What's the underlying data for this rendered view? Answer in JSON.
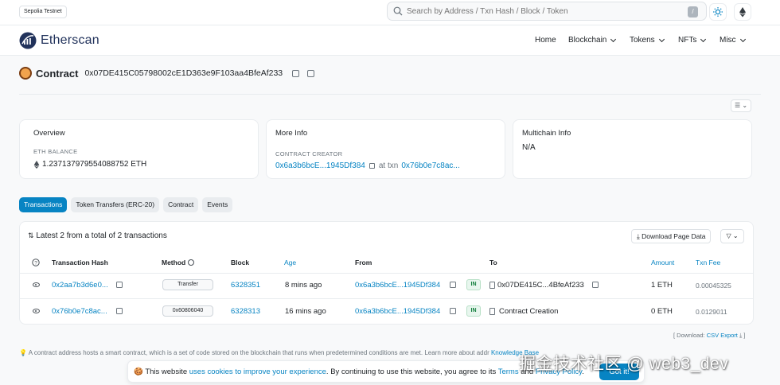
{
  "network_badge": "Sepolia Testnet",
  "search": {
    "placeholder": "Search by Address / Txn Hash / Block / Token",
    "shortcut": "/"
  },
  "brand": {
    "name": "Etherscan"
  },
  "nav": [
    {
      "label": "Home"
    },
    {
      "label": "Blockchain"
    },
    {
      "label": "Tokens"
    },
    {
      "label": "NFTs"
    },
    {
      "label": "Misc"
    }
  ],
  "contract": {
    "label": "Contract",
    "address": "0x07DE415C05798002cE1D363e9F103aa4BfeAf233"
  },
  "overview": {
    "title": "Overview",
    "balance_label": "ETH BALANCE",
    "balance_value": "1.237137979554088752 ETH"
  },
  "more_info": {
    "title": "More Info",
    "creator_label": "CONTRACT CREATOR",
    "creator_addr": "0x6a3b6bcE...1945Df384",
    "at_txn_text": "at txn",
    "creator_txn": "0x76b0e7c8ac..."
  },
  "multichain": {
    "title": "Multichain Info",
    "value": "N/A"
  },
  "tabs": [
    {
      "label": "Transactions"
    },
    {
      "label": "Token Transfers (ERC-20)"
    },
    {
      "label": "Contract"
    },
    {
      "label": "Events"
    }
  ],
  "txns": {
    "summary": "Latest 2 from a total of 2 transactions",
    "download_label": "Download Page Data",
    "columns": {
      "hash": "Transaction Hash",
      "method": "Method",
      "block": "Block",
      "age": "Age",
      "from": "From",
      "to": "To",
      "amount": "Amount",
      "fee": "Txn Fee"
    },
    "rows": [
      {
        "hash": "0x2aa7b3d6e0...",
        "method": "Transfer",
        "block": "6328351",
        "age": "8 mins ago",
        "from": "0x6a3b6bcE...1945Df384",
        "direction": "IN",
        "to": "0x07DE415C...4BfeAf233",
        "amount": "1 ETH",
        "fee": "0.00045325"
      },
      {
        "hash": "0x76b0e7c8ac...",
        "method": "0x60806040",
        "block": "6328313",
        "age": "16 mins ago",
        "from": "0x6a3b6bcE...1945Df384",
        "direction": "IN",
        "to": "Contract Creation",
        "amount": "0 ETH",
        "fee": "0.0129011"
      }
    ],
    "csv_prefix": "[ Download:",
    "csv_link": "CSV Export"
  },
  "note": "A contract address hosts a smart contract, which is a set of code stored on the blockchain that runs when predetermined conditions are met. Learn more about addr",
  "note_link": "Knowledge Base",
  "cookie": {
    "icon": "cookie-icon",
    "text_1": "This website",
    "link_1": "uses cookies to improve your experience",
    "text_2": ". By continuing to use this website, you agree to its",
    "link_2": "Terms",
    "text_3": "and",
    "link_3": "Privacy Policy",
    "text_4": ".",
    "button": "Got it!"
  },
  "watermark": "掘金技术社区 @ web3_dev",
  "colors": {
    "accent": "#0784c3",
    "brand": "#21325b",
    "in_badge": "#0f7d3a"
  }
}
